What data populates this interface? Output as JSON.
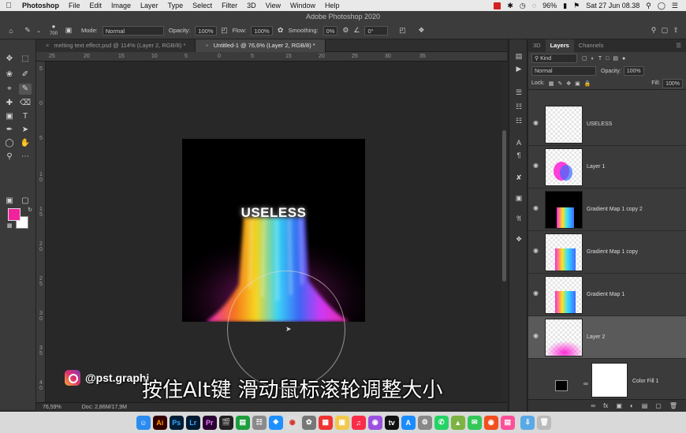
{
  "menubar": {
    "app": "Photoshop",
    "items": [
      "File",
      "Edit",
      "Image",
      "Layer",
      "Type",
      "Select",
      "Filter",
      "3D",
      "View",
      "Window",
      "Help"
    ],
    "battery": "96%",
    "datetime": "Sat 27 Jun  08.38"
  },
  "window_title": "Adobe Photoshop 2020",
  "options": {
    "brush_size": "700",
    "mode_label": "Mode:",
    "mode_value": "Normal",
    "opacity_label": "Opacity:",
    "opacity_value": "100%",
    "flow_label": "Flow:",
    "flow_value": "100%",
    "smoothing_label": "Smoothing:",
    "smoothing_value": "0%",
    "angle_value": "0°"
  },
  "tabs": [
    {
      "label": "melting text effect.psd @ 114% (Layer 2, RGB/8) *",
      "active": false
    },
    {
      "label": "Untitled-1 @ 76,6% (Layer 2, RGB/8) *",
      "active": true
    }
  ],
  "ruler": {
    "h_ticks": [
      "25",
      "20",
      "15",
      "10",
      "5",
      "0",
      "5",
      "10",
      "15",
      "20",
      "25",
      "30",
      "35"
    ],
    "v_ticks": [
      "5",
      "0",
      "5",
      "1\n0",
      "1\n5",
      "2\n0",
      "2\n5",
      "3\n0",
      "3\n5",
      "4\n0"
    ]
  },
  "canvas": {
    "text": "USELESS",
    "colors": {
      "foreground": "#f0229c",
      "background": "#ffffff"
    }
  },
  "status": {
    "zoom": "76,59%",
    "doc": "Doc: 2,86M/17,9M"
  },
  "panel": {
    "tabs": [
      "3D",
      "Layers",
      "Channels"
    ],
    "filter_value": "Kind",
    "blend_value": "Normal",
    "opacity_label": "Opacity:",
    "opacity_value": "100%",
    "lock_label": "Lock:",
    "fill_label": "Fill:",
    "fill_value": "100%",
    "layers": [
      {
        "name": "USELESS",
        "selected": false
      },
      {
        "name": "Layer 1",
        "selected": false
      },
      {
        "name": "Gradient Map 1 copy 2",
        "selected": false
      },
      {
        "name": "Gradient Map 1 copy",
        "selected": false
      },
      {
        "name": "Gradient Map 1",
        "selected": false
      },
      {
        "name": "Layer 2",
        "selected": true
      }
    ],
    "fill_layer": {
      "name": "Color Fill 1"
    }
  },
  "overlay": {
    "watermark": "@pst.graphi",
    "subtitle": "按住Alt键 滑动鼠标滚轮调整大小"
  },
  "dock": {
    "apps": [
      "Finder",
      "Illustrator",
      "Photoshop",
      "Lightroom",
      "Premiere",
      "Final Cut",
      "Numbers",
      "Launchpad",
      "Safari",
      "Chrome",
      "Photos",
      "Calendar",
      "Preview",
      "Music",
      "Podcasts",
      "TV",
      "App Store",
      "Settings",
      "WhatsApp",
      "Android",
      "Messages",
      "Figma",
      "Notes",
      "Downloads",
      "Trash"
    ]
  }
}
